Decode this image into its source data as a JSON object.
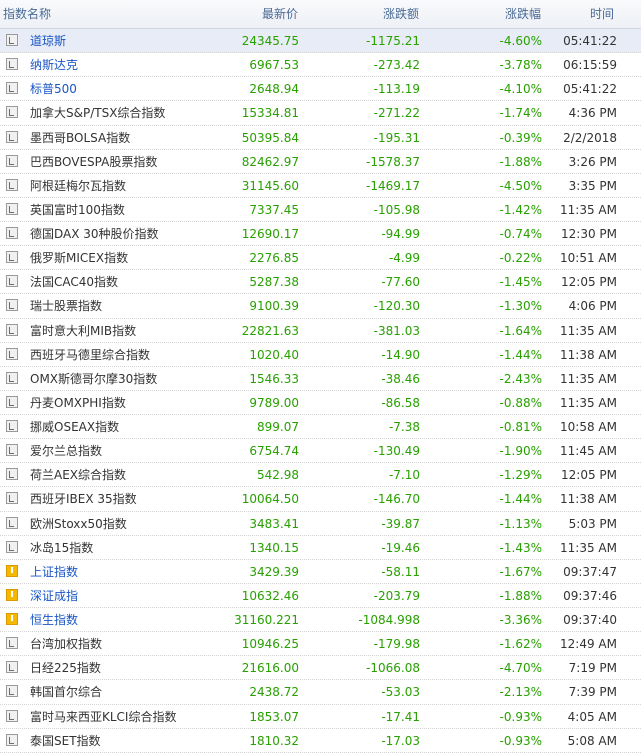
{
  "header": {
    "name": "指数名称",
    "price": "最新价",
    "change": "涨跌额",
    "pct": "涨跌幅",
    "time": "时间"
  },
  "colors": {
    "down": "#28a000",
    "link": "#1a56c6",
    "highlight_row": "#e7ecf7",
    "china_icon": "#f5b800"
  },
  "icons": {
    "default": "chart-icon",
    "china": "warning-icon"
  },
  "rows": [
    {
      "name": "道琼斯",
      "price": "24345.75",
      "change": "-1175.21",
      "pct": "-4.60%",
      "time": "05:41:22",
      "link": true,
      "icon": "chart",
      "highlight": true
    },
    {
      "name": "纳斯达克",
      "price": "6967.53",
      "change": "-273.42",
      "pct": "-3.78%",
      "time": "06:15:59",
      "link": true,
      "icon": "chart"
    },
    {
      "name": "标普500",
      "price": "2648.94",
      "change": "-113.19",
      "pct": "-4.10%",
      "time": "05:41:22",
      "link": true,
      "icon": "chart"
    },
    {
      "name": "加拿大S&P/TSX综合指数",
      "price": "15334.81",
      "change": "-271.22",
      "pct": "-1.74%",
      "time": "4:36 PM",
      "icon": "chart"
    },
    {
      "name": "墨西哥BOLSA指数",
      "price": "50395.84",
      "change": "-195.31",
      "pct": "-0.39%",
      "time": "2/2/2018",
      "icon": "chart"
    },
    {
      "name": "巴西BOVESPA股票指数",
      "price": "82462.97",
      "change": "-1578.37",
      "pct": "-1.88%",
      "time": "3:26 PM",
      "icon": "chart"
    },
    {
      "name": "阿根廷梅尔瓦指数",
      "price": "31145.60",
      "change": "-1469.17",
      "pct": "-4.50%",
      "time": "3:35 PM",
      "icon": "chart"
    },
    {
      "name": "英国富时100指数",
      "price": "7337.45",
      "change": "-105.98",
      "pct": "-1.42%",
      "time": "11:35 AM",
      "icon": "chart"
    },
    {
      "name": "德国DAX 30种股价指数",
      "price": "12690.17",
      "change": "-94.99",
      "pct": "-0.74%",
      "time": "12:30 PM",
      "icon": "chart"
    },
    {
      "name": "俄罗斯MICEX指数",
      "price": "2276.85",
      "change": "-4.99",
      "pct": "-0.22%",
      "time": "10:51 AM",
      "icon": "chart"
    },
    {
      "name": "法国CAC40指数",
      "price": "5287.38",
      "change": "-77.60",
      "pct": "-1.45%",
      "time": "12:05 PM",
      "icon": "chart"
    },
    {
      "name": "瑞士股票指数",
      "price": "9100.39",
      "change": "-120.30",
      "pct": "-1.30%",
      "time": "4:06 PM",
      "icon": "chart"
    },
    {
      "name": "富时意大利MIB指数",
      "price": "22821.63",
      "change": "-381.03",
      "pct": "-1.64%",
      "time": "11:35 AM",
      "icon": "chart"
    },
    {
      "name": "西班牙马德里综合指数",
      "price": "1020.40",
      "change": "-14.90",
      "pct": "-1.44%",
      "time": "11:38 AM",
      "icon": "chart"
    },
    {
      "name": "OMX斯德哥尔摩30指数",
      "price": "1546.33",
      "change": "-38.46",
      "pct": "-2.43%",
      "time": "11:35 AM",
      "icon": "chart"
    },
    {
      "name": "丹麦OMXPHI指数",
      "price": "9789.00",
      "change": "-86.58",
      "pct": "-0.88%",
      "time": "11:35 AM",
      "icon": "chart"
    },
    {
      "name": "挪威OSEAX指数",
      "price": "899.07",
      "change": "-7.38",
      "pct": "-0.81%",
      "time": "10:58 AM",
      "icon": "chart"
    },
    {
      "name": "爱尔兰总指数",
      "price": "6754.74",
      "change": "-130.49",
      "pct": "-1.90%",
      "time": "11:45 AM",
      "icon": "chart"
    },
    {
      "name": "荷兰AEX综合指数",
      "price": "542.98",
      "change": "-7.10",
      "pct": "-1.29%",
      "time": "12:05 PM",
      "icon": "chart"
    },
    {
      "name": "西班牙IBEX 35指数",
      "price": "10064.50",
      "change": "-146.70",
      "pct": "-1.44%",
      "time": "11:38 AM",
      "icon": "chart"
    },
    {
      "name": "欧洲Stoxx50指数",
      "price": "3483.41",
      "change": "-39.87",
      "pct": "-1.13%",
      "time": "5:03 PM",
      "icon": "chart"
    },
    {
      "name": "冰岛15指数",
      "price": "1340.15",
      "change": "-19.46",
      "pct": "-1.43%",
      "time": "11:35 AM",
      "icon": "chart"
    },
    {
      "name": "上证指数",
      "price": "3429.39",
      "change": "-58.11",
      "pct": "-1.67%",
      "time": "09:37:47",
      "link": true,
      "icon": "china"
    },
    {
      "name": "深证成指",
      "price": "10632.46",
      "change": "-203.79",
      "pct": "-1.88%",
      "time": "09:37:46",
      "link": true,
      "icon": "china"
    },
    {
      "name": "恒生指数",
      "price": "31160.221",
      "change": "-1084.998",
      "pct": "-3.36%",
      "time": "09:37:40",
      "link": true,
      "icon": "china"
    },
    {
      "name": "台湾加权指数",
      "price": "10946.25",
      "change": "-179.98",
      "pct": "-1.62%",
      "time": "12:49 AM",
      "icon": "chart"
    },
    {
      "name": "日经225指数",
      "price": "21616.00",
      "change": "-1066.08",
      "pct": "-4.70%",
      "time": "7:19 PM",
      "icon": "chart"
    },
    {
      "name": "韩国首尔综合",
      "price": "2438.72",
      "change": "-53.03",
      "pct": "-2.13%",
      "time": "7:39 PM",
      "icon": "chart"
    },
    {
      "name": "富时马来西亚KLCI综合指数",
      "price": "1853.07",
      "change": "-17.41",
      "pct": "-0.93%",
      "time": "4:05 AM",
      "icon": "chart"
    },
    {
      "name": "泰国SET指数",
      "price": "1810.32",
      "change": "-17.03",
      "pct": "-0.93%",
      "time": "5:08 AM",
      "icon": "chart"
    }
  ]
}
